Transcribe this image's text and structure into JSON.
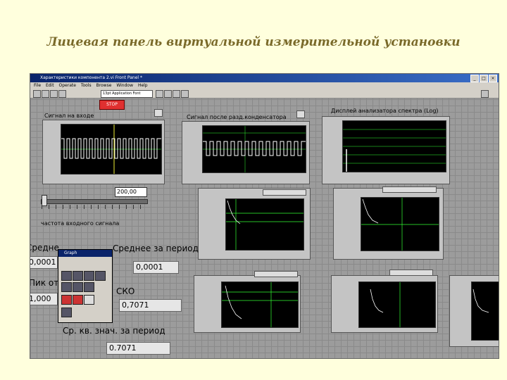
{
  "slide": {
    "title": "Лицевая панель виртуальной измерительной установки"
  },
  "window": {
    "title": "Характеристики компонента 2.vi Front Panel *",
    "menu": [
      "File",
      "Edit",
      "Operate",
      "Tools",
      "Browse",
      "Window",
      "Help"
    ],
    "font_selector": "13pt Application Font",
    "controls": [
      "_",
      "□",
      "×"
    ]
  },
  "panel": {
    "stop_label": "STOP",
    "graph1_label": "Сигнал на входе",
    "graph2_label": "Сигнал после разд.конденсатора",
    "graph3_label": "Дисплей анализатора спектра (Log)",
    "freq_value": "200,00",
    "freq_label": "частота входного сигнала",
    "mean_label": "Среднее за период",
    "mean_value": "0,0001",
    "mean_left_label": "Средне",
    "mean_left_value": "0,0001",
    "peak_label": "Пик от",
    "peak_value": "1,000",
    "rms_label": "СКО",
    "rms_value": "0,7071",
    "rmsavg_label": "Ср. кв. знач. за период",
    "rmsavg_value": "0.7071",
    "palette_title": "Graph"
  }
}
